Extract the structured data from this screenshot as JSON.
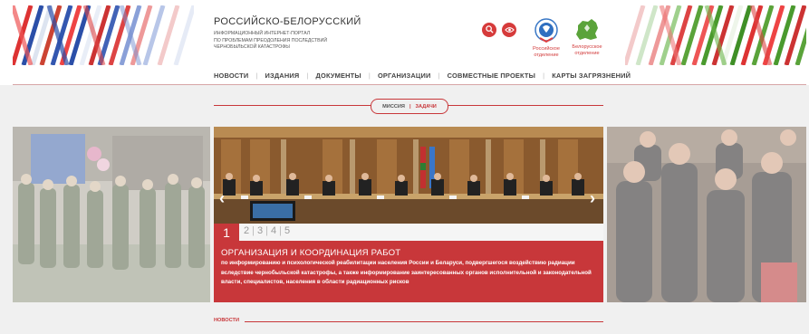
{
  "portal": {
    "title": "РОССИЙСКО-БЕЛОРУССКИЙ",
    "subtitle_lines": [
      "ИНФОРМАЦИОННЫЙ ИНТЕРНЕТ-ПОРТАЛ",
      "ПО ПРОБЛЕМАМ ПРЕОДОЛЕНИЯ ПОСЛЕДСТВИЙ",
      "ЧЕРНОБЫЛЬСКОЙ КАТАСТРОФЫ"
    ]
  },
  "branches": [
    {
      "line1": "Российское",
      "line2": "отделение"
    },
    {
      "line1": "Белорусское",
      "line2": "отделение"
    }
  ],
  "icons": {
    "search": "search-icon",
    "view": "eye-icon",
    "prev": "chevron-left-icon",
    "next": "chevron-right-icon"
  },
  "nav": [
    "НОВОСТИ",
    "ИЗДАНИЯ",
    "ДОКУМЕНТЫ",
    "ОРГАНИЗАЦИИ",
    "СОВМЕСТНЫЕ ПРОЕКТЫ",
    "КАРТЫ ЗАГРЯЗНЕНИЙ"
  ],
  "tabs": {
    "mission": "МИССИЯ",
    "tasks": "ЗАДАЧИ",
    "active": "ЗАДАЧИ"
  },
  "slider": {
    "current": "1",
    "pages": [
      "2",
      "3",
      "4",
      "5"
    ],
    "title": "ОРГАНИЗАЦИЯ И КООРДИНАЦИЯ РАБОТ",
    "text": "по информированию и психологической реабилитации населения России и Беларуси, подвергшегося воздействию радиации вследствие чернобыльской катастрофы, а также информирование заинтересованных органов исполнительной и законодательной власти, специалистов, населения в области радиационных рисков"
  },
  "news_section": "НОВОСТИ",
  "colors": {
    "accent": "#c8373a",
    "background": "#f0f0f0"
  }
}
